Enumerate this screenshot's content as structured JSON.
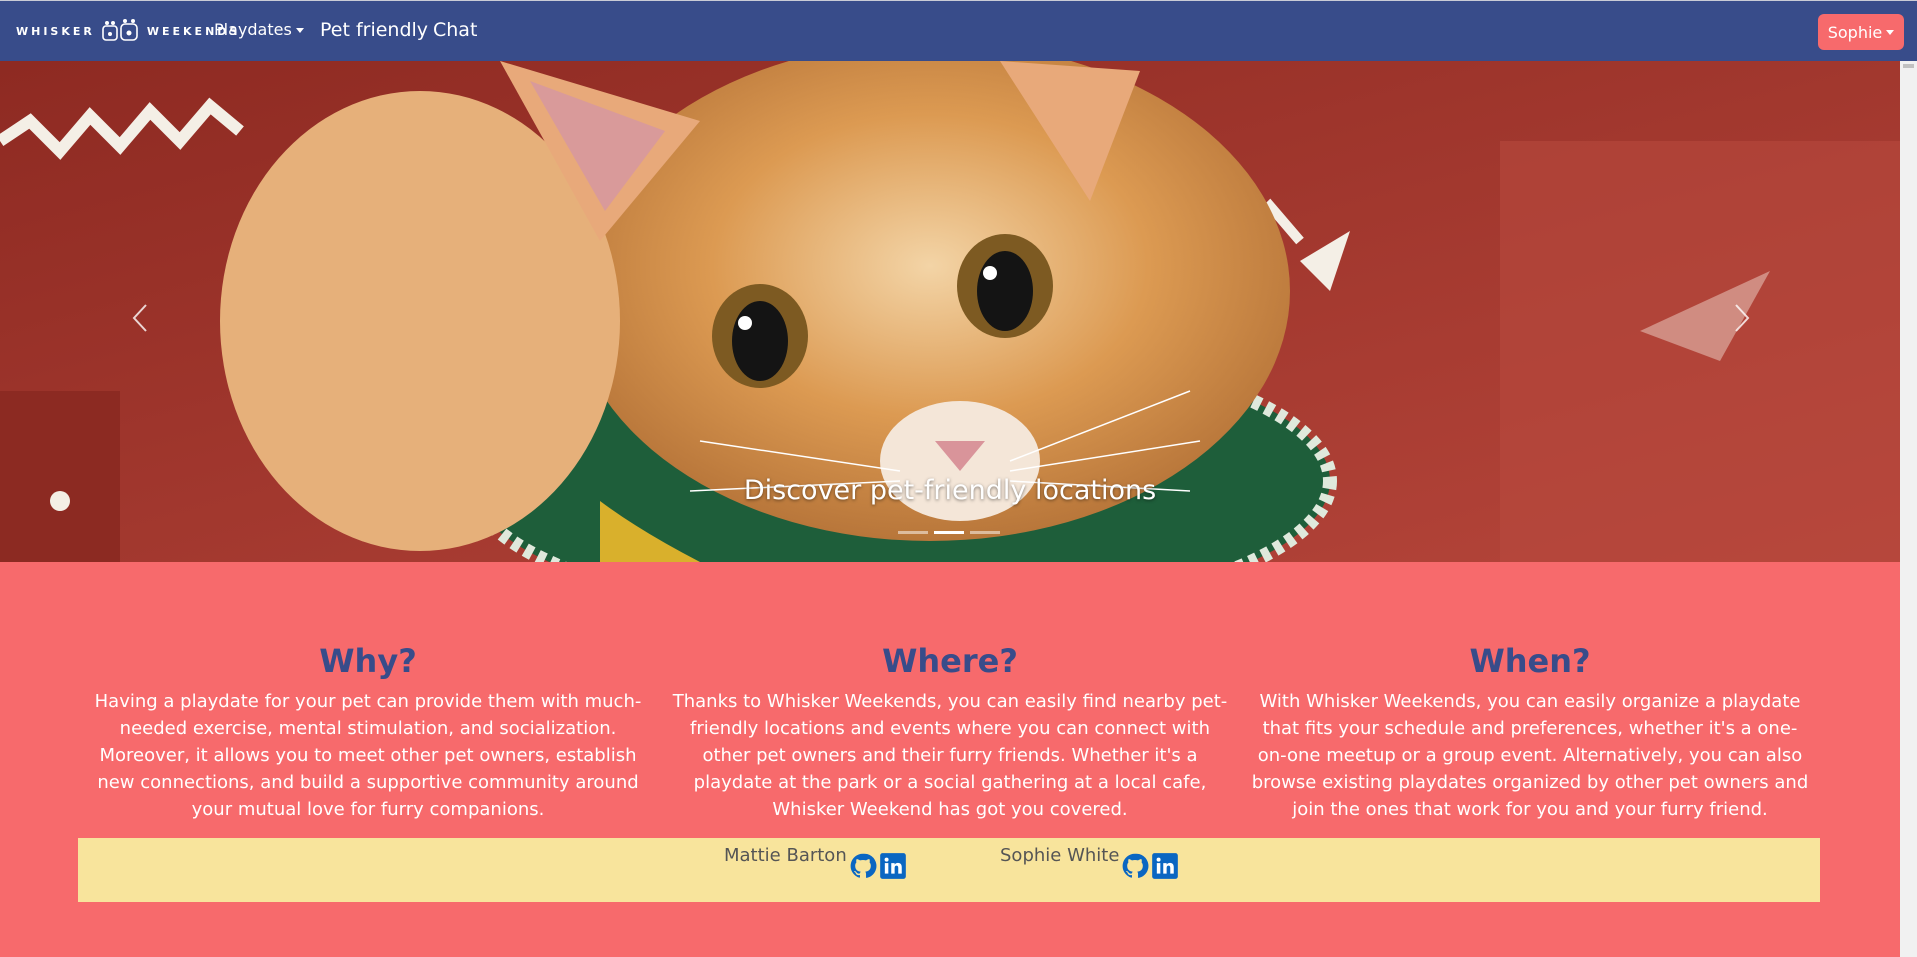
{
  "navbar": {
    "brand_left": "WHISKER",
    "brand_right": "WEEKENDS",
    "playdates_label": "Playdates",
    "pet_friendly_label": "Pet friendly",
    "chat_label": "Chat",
    "user_label": "Sophie"
  },
  "carousel": {
    "caption": "Discover pet-friendly locations",
    "slide_count": 3,
    "active_slide": 2
  },
  "sections": [
    {
      "heading": "Why?",
      "text": "Having a playdate for your pet can provide them with much-needed exercise, mental stimulation, and socialization. Moreover, it allows you to meet other pet owners, establish new connections, and build a supportive community around your mutual love for furry companions."
    },
    {
      "heading": "Where?",
      "text": "Thanks to Whisker Weekends, you can easily find nearby pet-friendly locations and events where you can connect with other pet owners and their furry friends. Whether it's a playdate at the park or a social gathering at a local cafe, Whisker Weekend has got you covered."
    },
    {
      "heading": "When?",
      "text": "With Whisker Weekends, you can easily organize a playdate that fits your schedule and preferences, whether it's a one-on-one meetup or a group event. Alternatively, you can also browse existing playdates organized by other pet owners and join the ones that work for you and your furry friend."
    }
  ],
  "footer": {
    "authors": [
      {
        "name": "Mattie Barton"
      },
      {
        "name": "Sophie White"
      }
    ]
  },
  "colors": {
    "navbar": "#384c8a",
    "page_background": "#f76a6c",
    "heading": "#384c8a",
    "footer_background": "#f8e49c",
    "social_icon": "#0a66c2"
  },
  "icons": [
    "paw-logo-icon",
    "caret-down-icon",
    "chevron-left-icon",
    "chevron-right-icon",
    "github-icon",
    "linkedin-icon"
  ]
}
